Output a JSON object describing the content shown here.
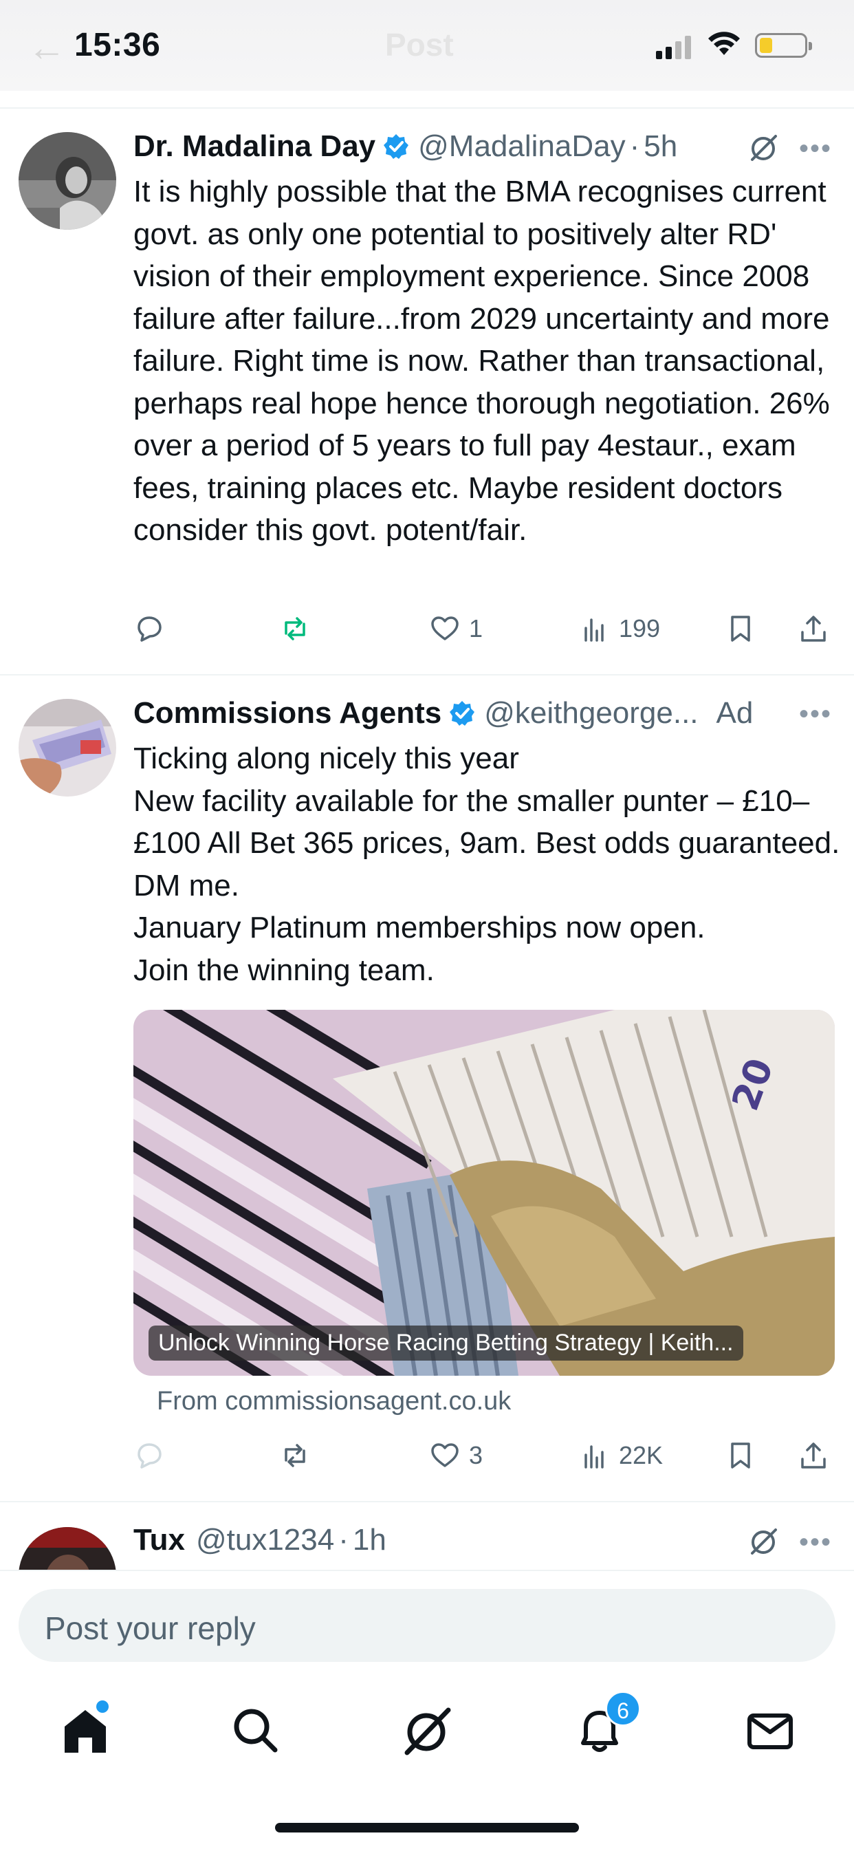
{
  "status_bar": {
    "time": "15:36"
  },
  "header": {
    "title": "Post",
    "back_icon": "arrow-left-icon"
  },
  "posts": [
    {
      "name": "Dr. Madalina Day",
      "verified": true,
      "handle": "@MadalinaDay",
      "separator": "·",
      "time": "5h",
      "text": "It is highly possible that the BMA recognises current govt. as only one potential to positively alter RD' vision of their employment experience. Since 2008 failure after failure...from 2029 uncertainty and more failure. Right time is now. Rather than transactional, perhaps real hope hence thorough negotiation. 26% over a period of 5 years to full pay 4estaur., exam fees, training places etc. Maybe resident doctors consider this govt. potent/fair.",
      "actions": {
        "replies": "",
        "reposts": "",
        "likes": "1",
        "views": "199"
      }
    },
    {
      "name": "Commissions Agents",
      "verified": true,
      "handle": "@keithgeorge...",
      "ad_label": "Ad",
      "text": "Ticking along nicely this year\nNew facility available for the smaller punter – £10–£100 All Bet 365 prices, 9am. Best odds guaranteed. DM me.\nJanuary Platinum memberships now open.\nJoin the winning team.",
      "card_caption": "Unlock Winning Horse Racing Betting Strategy | Keith...",
      "card_source": "From commissionsagent.co.uk",
      "actions": {
        "replies": "",
        "reposts": "",
        "likes": "3",
        "views": "22K"
      }
    },
    {
      "name": "Tux",
      "handle": "@tux1234",
      "separator": "·",
      "time": "1h"
    }
  ],
  "reply": {
    "placeholder": "Post your reply"
  },
  "nav": {
    "items": [
      "home-icon",
      "search-icon",
      "grok-icon",
      "bell-icon",
      "mail-icon"
    ],
    "notifications_count": "6"
  },
  "colors": {
    "accent": "#1d9bf0",
    "repost_active": "#00ba7c",
    "text": "#0f1419",
    "muted": "#536471"
  }
}
